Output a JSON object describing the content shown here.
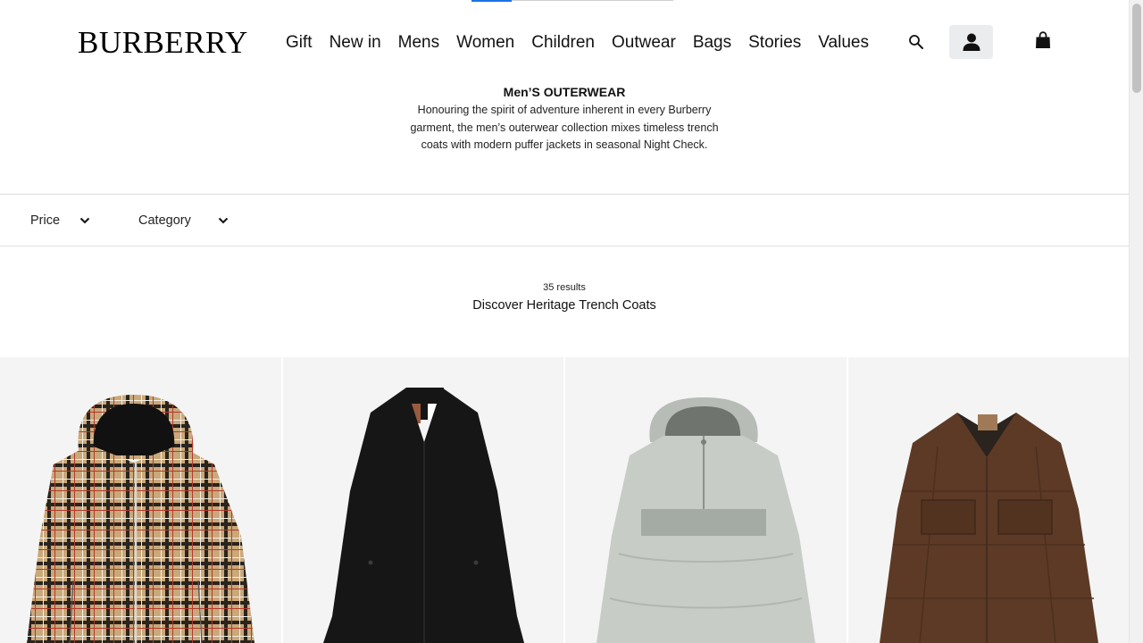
{
  "header": {
    "logo": "BURBERRY",
    "nav": [
      "Gift",
      "New in",
      "Mens",
      "Women",
      "Children",
      "Outwear",
      "Bags",
      "Stories",
      "Values"
    ],
    "icons": {
      "search": "search-icon",
      "account": "user-icon",
      "bag": "shopping-bag-icon"
    }
  },
  "intro": {
    "title": "Men’S OUTERWEAR",
    "description": "Honouring the spirit of adventure inherent in every Burberry garment, the men’s outerwear collection mixes timeless trench coats with modern puffer jackets in seasonal Night Check."
  },
  "filters": [
    {
      "label": "Price",
      "icon": "chevron-down-icon"
    },
    {
      "label": "Category",
      "icon": "chevron-down-icon"
    }
  ],
  "results": {
    "count": "35 results",
    "heading": "Discover Heritage Trench Coats"
  },
  "products": [
    {
      "image": "beige-check-hooded-jacket"
    },
    {
      "image": "black-car-coat"
    },
    {
      "image": "grey-puffer-anorak"
    },
    {
      "image": "brown-quilted-jacket"
    }
  ],
  "colors": {
    "accent": "#1a73e8",
    "card_bg": "#f4f4f4",
    "account_bg": "#eaecee"
  }
}
